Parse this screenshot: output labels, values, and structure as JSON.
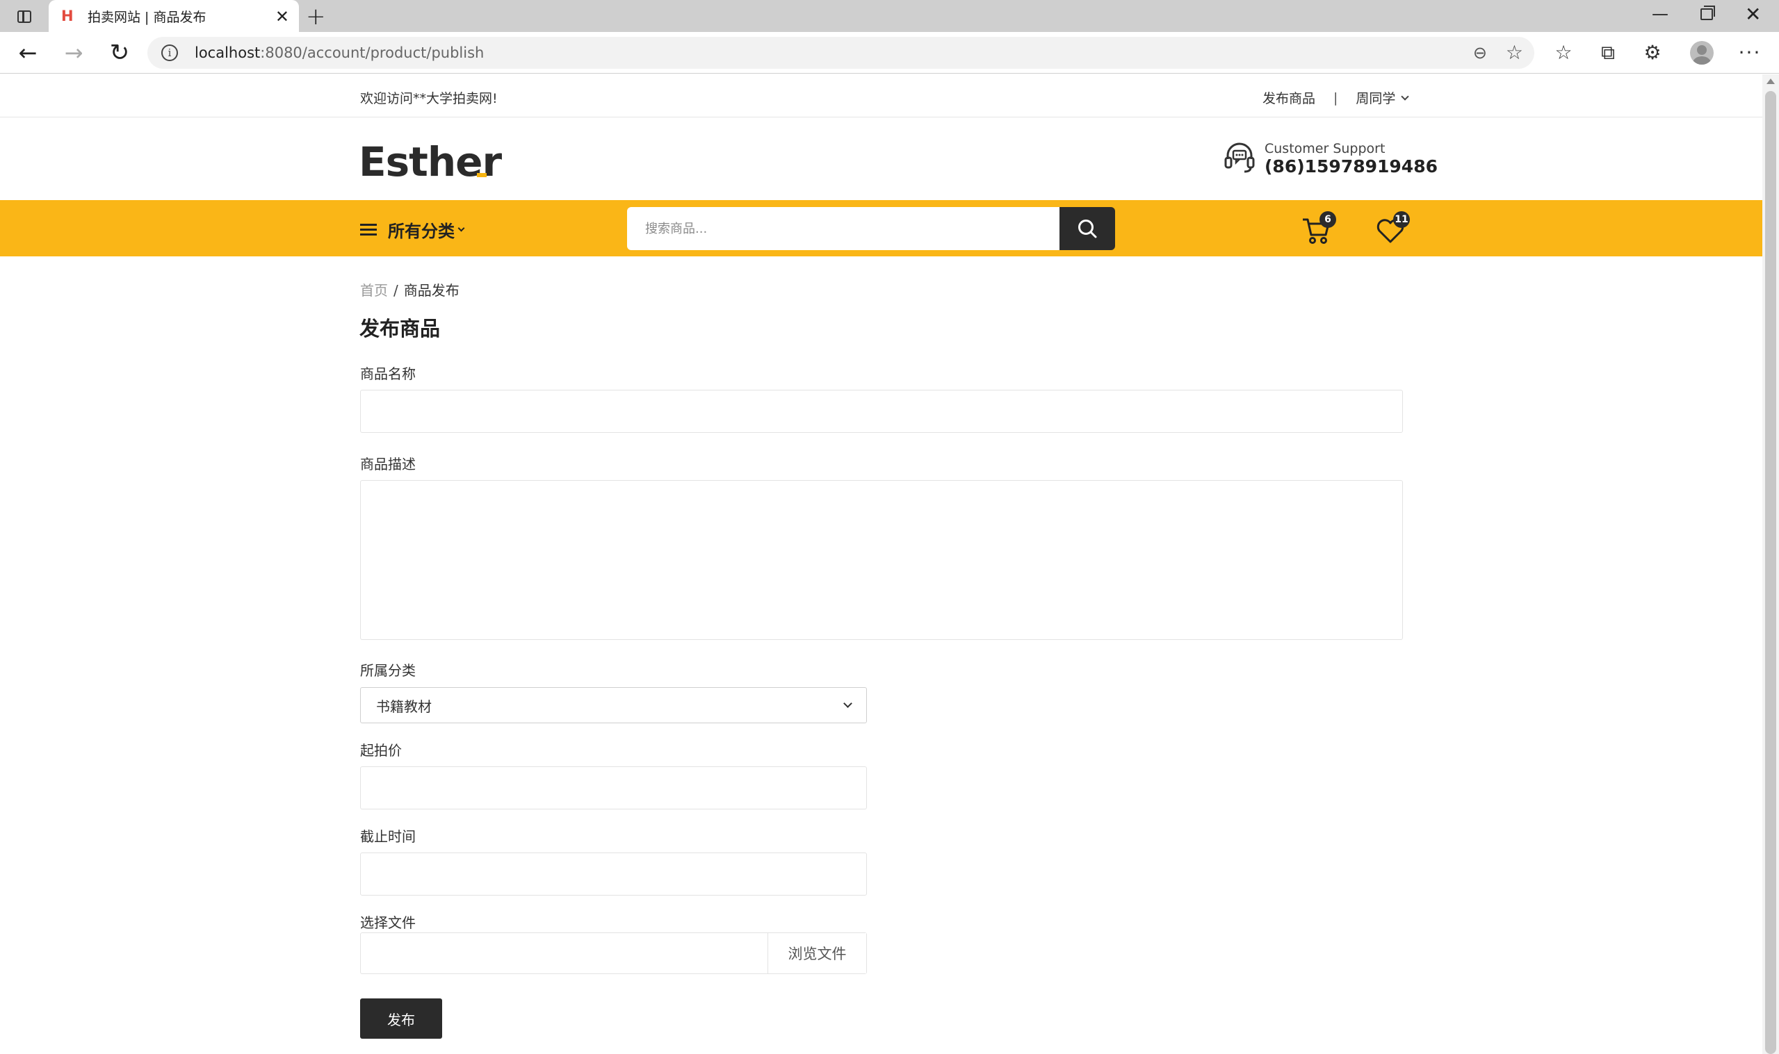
{
  "browser": {
    "tab_title": "拍卖网站 | 商品发布",
    "url_host": "localhost",
    "url_rest": ":8080/account/product/publish"
  },
  "topbar": {
    "welcome": "欢迎访问**大学拍卖网!",
    "publish_link": "发布商品",
    "separator": "|",
    "user_name": "周同学"
  },
  "header": {
    "logo": "Esther",
    "support_label": "Customer Support",
    "support_phone": "(86)15978919486"
  },
  "navbar": {
    "categories_label": "所有分类",
    "search_placeholder": "搜索商品...",
    "cart_count": "6",
    "wishlist_count": "11",
    "accent_color": "#fab617"
  },
  "breadcrumb": {
    "home": "首页",
    "separator": "/",
    "current": "商品发布"
  },
  "form": {
    "title": "发布商品",
    "name_label": "商品名称",
    "name_value": "",
    "desc_label": "商品描述",
    "desc_value": "",
    "category_label": "所属分类",
    "category_selected": "书籍教材",
    "price_label": "起拍价",
    "price_value": "",
    "deadline_label": "截止时间",
    "deadline_value": "",
    "file_label": "选择文件",
    "file_browse": "浏览文件",
    "submit": "发布"
  }
}
